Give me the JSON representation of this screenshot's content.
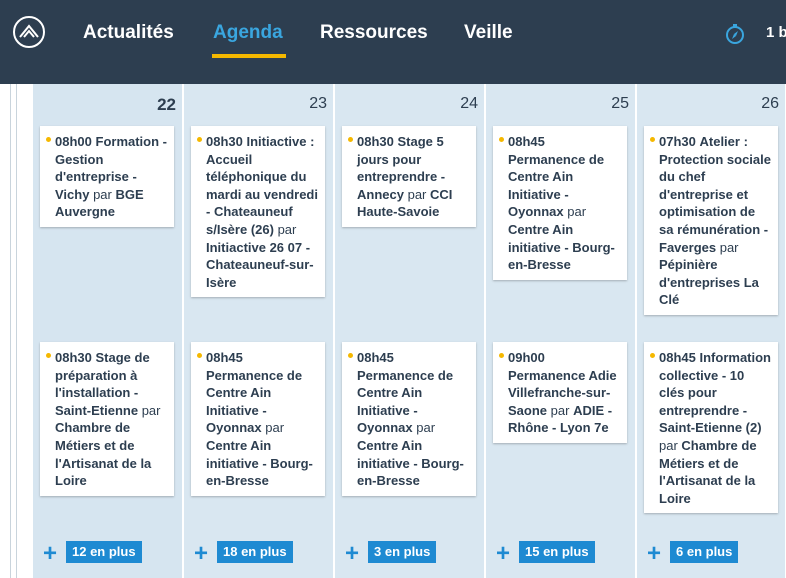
{
  "nav": {
    "items": [
      "Actualités",
      "Agenda",
      "Ressources",
      "Veille"
    ],
    "active": "Agenda",
    "user_text": "1 b"
  },
  "colors": {
    "topbar": "#2d3e50",
    "active_nav": "#3aa6df",
    "underline": "#f5b800",
    "day_bg": "#d9e7f1",
    "badge": "#1e8ad2",
    "dot": "#f5b800"
  },
  "icons": {
    "logo": "mountain-logo-icon",
    "compass": "compass-icon",
    "dot": "bullet-dot-icon",
    "plus": "plus-icon"
  },
  "days": [
    {
      "num": "22",
      "events": [
        {
          "time": "08h00",
          "title": "Formation - Gestion d'entreprise - Vichy",
          "par": "par",
          "org": "BGE Auvergne"
        },
        {
          "time": "08h30",
          "title": "Stage de préparation à l'installation - Saint-Etienne",
          "par": "par",
          "org": "Chambre de Métiers et de l'Artisanat de la Loire"
        }
      ],
      "more": "12 en plus"
    },
    {
      "num": "23",
      "events": [
        {
          "time": "08h30",
          "title": "Initiactive : Accueil téléphonique du mardi au vendredi - Chateauneuf s/Isère (26)",
          "par": "par",
          "org": "Initiactive 26 07 - Chateauneuf-sur-Isère"
        },
        {
          "time": "08h45",
          "title": "Permanence de Centre Ain Initiative - Oyonnax",
          "par": "par",
          "org": "Centre Ain initiative - Bourg-en-Bresse"
        }
      ],
      "more": "18 en plus"
    },
    {
      "num": "24",
      "events": [
        {
          "time": "08h30",
          "title": "Stage 5 jours pour entreprendre - Annecy",
          "par": "par",
          "org": "CCI Haute-Savoie"
        },
        {
          "time": "08h45",
          "title": "Permanence de Centre Ain Initiative - Oyonnax",
          "par": "par",
          "org": "Centre Ain initiative - Bourg-en-Bresse"
        }
      ],
      "more": "3 en plus"
    },
    {
      "num": "25",
      "events": [
        {
          "time": "08h45",
          "title": "Permanence de Centre Ain Initiative - Oyonnax",
          "par": "par",
          "org": "Centre Ain initiative - Bourg-en-Bresse"
        },
        {
          "time": "09h00",
          "title": "Permanence Adie Villefranche-sur-Saone",
          "par": "par",
          "org": "ADIE - Rhône - Lyon 7e"
        }
      ],
      "more": "15 en plus"
    },
    {
      "num": "26",
      "events": [
        {
          "time": "07h30",
          "title": "Atelier : Protection sociale du chef d'entreprise et optimisation de sa rémunération - Faverges",
          "par": "par",
          "org": "Pépinière d'entreprises La Clé"
        },
        {
          "time": "08h45",
          "title": "Information collective - 10 clés pour entreprendre - Saint-Etienne (2)",
          "par": "par",
          "org": "Chambre de Métiers et de l'Artisanat de la Loire"
        }
      ],
      "more": "6 en plus"
    }
  ]
}
